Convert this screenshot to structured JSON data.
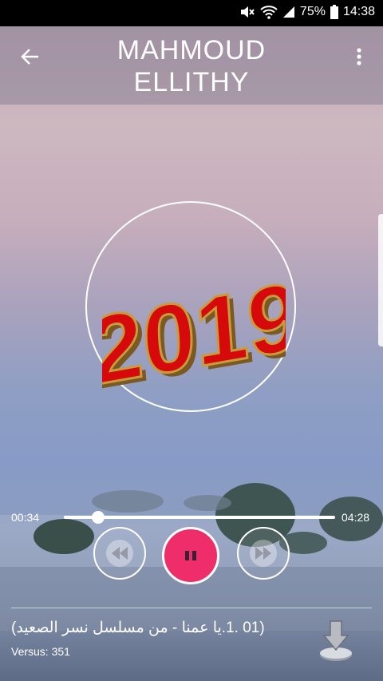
{
  "status_bar": {
    "battery": "75%",
    "time": "14:38"
  },
  "header": {
    "title": "MAHMOUD ELLITHY"
  },
  "album": {
    "art_text": "2019"
  },
  "player": {
    "elapsed": "00:34",
    "duration": "04:28",
    "progress": 0.127
  },
  "track": {
    "title": "(01 .1.يا عمنا - من مسلسل نسر الصعيد)",
    "versus": "Versus: 351"
  },
  "colors": {
    "accent": "#ef2d6a",
    "album_red": "#d60a0a",
    "album_gold": "#c89b3c"
  },
  "icons": [
    "mute-icon",
    "wifi-icon",
    "signal-icon",
    "battery-icon",
    "back-arrow-icon",
    "more-vert-icon",
    "rewind-icon",
    "pause-icon",
    "fast-forward-icon",
    "download-icon"
  ]
}
